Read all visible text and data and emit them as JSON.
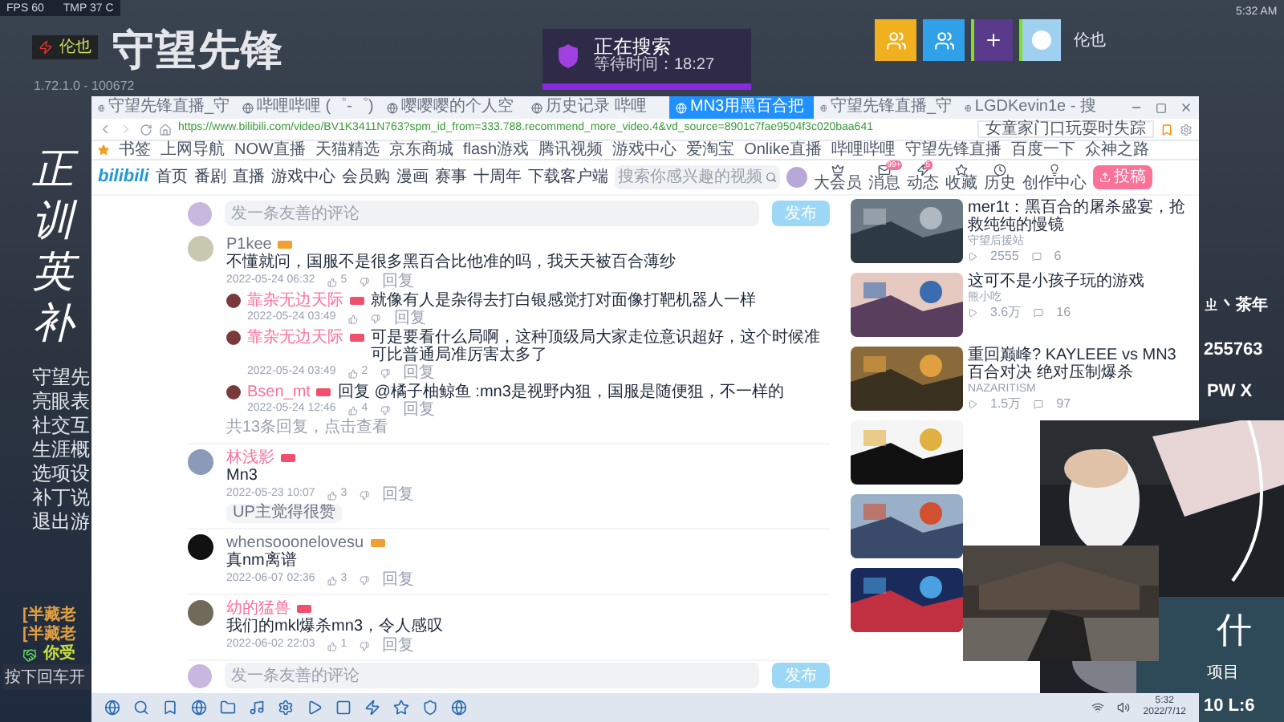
{
  "game_overlay": {
    "stats": [
      {
        "label": "FPS",
        "value": "60"
      },
      {
        "label": "TMP",
        "value": "37 C"
      }
    ],
    "player_name": "伦也",
    "logo": "守望先锋",
    "version": "1.72.1.0 - 100672",
    "menu_big": [
      "正",
      "训",
      "英",
      "补"
    ],
    "menu": [
      "守望先",
      "亮眼表",
      "社交互",
      "生涯概",
      "选项设",
      "补丁说",
      "退出游"
    ],
    "chat": [
      {
        "kind": "message",
        "text": "[半藏老"
      },
      {
        "kind": "message",
        "text": "[半藏老"
      },
      {
        "kind": "notice",
        "text": "你受"
      }
    ],
    "chat_input": {
      "placeholder": "按下回车开"
    }
  },
  "matchmaking": {
    "status": "正在搜索",
    "wait": "等待时间：18:27"
  },
  "top_bar": {
    "player_name": "伦也",
    "clock": "5:32 AM"
  },
  "browser": {
    "tabs": [
      {
        "title": "守望先锋直播_守",
        "selected": false
      },
      {
        "title": "哔哩哔哩 (゜-゜)",
        "selected": false
      },
      {
        "title": "嘤嘤嘤的个人空",
        "selected": false
      },
      {
        "title": "历史记录 哔哩",
        "selected": false
      },
      {
        "title": "MN3用黑百合把",
        "selected": true
      },
      {
        "title": "守望先锋直播_守",
        "selected": false
      },
      {
        "title": "LGDKevin1e - 搜",
        "selected": false
      }
    ],
    "address": {
      "url": "https://www.bilibili.com/video/BV1K3411N763?spm_id_from=333.788.recommend_more_video.4&vd_source=8901c7fae9504f3c020baa641",
      "search_hint": "女童家门口玩耍时失踪"
    },
    "bookmarks": [
      "书签",
      "上网导航",
      "NOW直播",
      "天猫精选",
      "京东商城",
      "flash游戏",
      "腾讯视频",
      "游戏中心",
      "爱淘宝",
      "Onlike直播",
      "哔哩哔哩",
      "守望先锋直播",
      "百度一下",
      "众神之路"
    ],
    "site_nav": {
      "logo": "bilibili",
      "items": [
        "首页",
        "番剧",
        "直播",
        "游戏中心",
        "会员购",
        "漫画",
        "赛事",
        "十周年",
        "下载客户端"
      ],
      "search": {
        "placeholder": "搜索你感兴趣的视频"
      },
      "actions": [
        {
          "label": "大会员"
        },
        {
          "label": "消息",
          "badge": "99+"
        },
        {
          "label": "动态",
          "badge": "5"
        },
        {
          "label": "收藏"
        },
        {
          "label": "历史"
        },
        {
          "label": "创作中心"
        }
      ],
      "upload": "投稿"
    },
    "comment_box_top": {
      "placeholder": "发一条友善的评论",
      "submit": "发布"
    },
    "comments": [
      {
        "user": "P1kee",
        "vip": false,
        "text": "不懂就问，国服不是很多黑百合比他准的吗，我天天被百合薄纱",
        "time": "2022-05-24 06:32",
        "likes": "5",
        "reply": "回复",
        "replies": [
          {
            "user": "靠杂无边天际",
            "vip": true,
            "text": "就像有人是杂得去打白银感觉打对面像打靶机器人一样",
            "time": "2022-05-24 03:49",
            "reply": "回复"
          },
          {
            "user": "靠杂无边天际",
            "vip": true,
            "text": "可是要看什么局啊，这种顶级局大家走位意识超好，这个时候准可比普通局准厉害太多了",
            "time": "2022-05-24 03:49",
            "likes": "2",
            "reply": "回复"
          },
          {
            "user": "Bsen_mt",
            "vip": true,
            "text": "回复 @橘子柚鲸鱼 :mn3是视野内狙，国服是随便狙，不一样的",
            "time": "2022-05-24 12:46",
            "likes": "4",
            "reply": "回复"
          }
        ],
        "more": "共13条回复，点击查看"
      },
      {
        "user": "林浅影",
        "vip": true,
        "text": "Mn3",
        "time": "2022-05-23 10:07",
        "likes": "3",
        "reply": "回复",
        "tag": "UP主觉得很赞"
      },
      {
        "user": "whensooonelovesu",
        "vip": false,
        "text": "真nm离谱",
        "time": "2022-06-07 02:36",
        "likes": "3",
        "reply": "回复"
      },
      {
        "user": "幼的猛兽",
        "vip": true,
        "text": "我们的mkl爆杀mn3，令人感叹",
        "time": "2022-06-02 22:03",
        "likes": "1",
        "reply": "回复"
      }
    ],
    "comment_box_bottom": {
      "placeholder": "发一条友善的评论",
      "submit": "发布"
    },
    "recommendations": [
      {
        "kind": "video",
        "title": "mer1t：黑百合的屠杀盛宴，抢救纯纯的慢镜",
        "up": "守望后援站",
        "views": "2555",
        "danmaku": "6"
      },
      {
        "kind": "video",
        "title": "这可不是小孩子玩的游戏",
        "up": "熊小吃",
        "views": "3.6万",
        "danmaku": "16"
      },
      {
        "kind": "video",
        "title": "重回巅峰? KAYLEEE vs MN3 百合对决 绝对压制爆杀",
        "up": "NAZARITISM",
        "views": "1.5万",
        "danmaku": "97"
      },
      {
        "kind": "picture"
      },
      {
        "kind": "picture"
      },
      {
        "kind": "picture"
      }
    ]
  },
  "stream_overlay": {
    "name": "ㄓ丶茶年",
    "number": "255763",
    "device": "PW X",
    "big_char": "什",
    "label": "项目",
    "score": "10 L:6"
  },
  "taskbar": {
    "time": "5:32",
    "date": "2022/7/12"
  }
}
